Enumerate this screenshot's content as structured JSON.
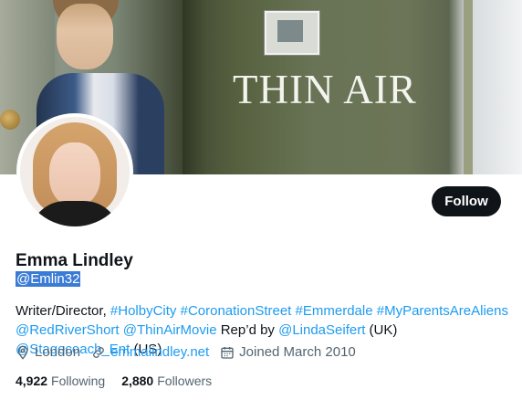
{
  "banner": {
    "title": "THIN AIR"
  },
  "profile": {
    "follow_label": "Follow",
    "name": "Emma Lindley",
    "handle": "@Emlin32",
    "bio": {
      "prefix": "Writer/Director, ",
      "tags": [
        "#HolbyCity",
        "#CoronationStreet",
        "#Emmerdale",
        "#MyParentsAreAliens"
      ],
      "mention1": "@RedRiverShort",
      "mention2": "@ThinAirMovie",
      "text_repd": "Rep’d by",
      "mention3": "@LindaSeifert",
      "uk": "(UK)",
      "mention4": "@Stagecoach_Ent",
      "us": "(US)"
    },
    "location": "London",
    "website": "emmalindley.net",
    "joined": "Joined March 2010",
    "following_count": "4,922",
    "following_label": "Following",
    "followers_count": "2,880",
    "followers_label": "Followers"
  },
  "icons": {
    "location": "location-pin-icon",
    "link": "link-icon",
    "calendar": "calendar-icon"
  },
  "colors": {
    "link": "#1d9bf0",
    "follow_bg": "#0f1419",
    "secondary": "#536471"
  }
}
